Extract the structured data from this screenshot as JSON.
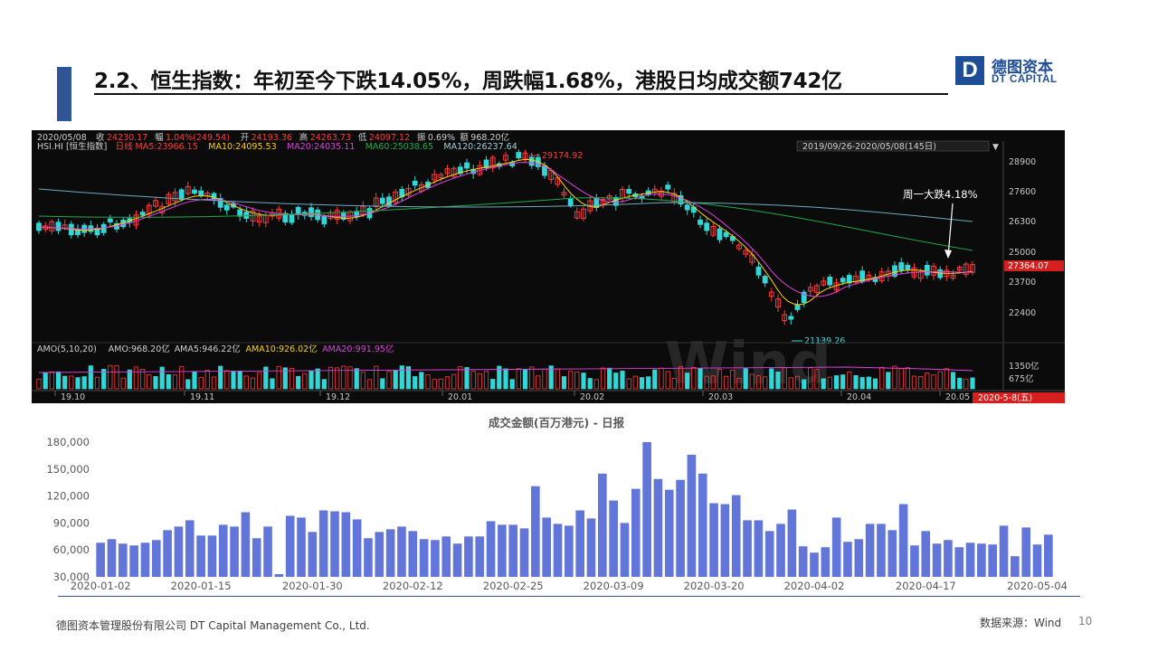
{
  "slide": {
    "title": "2.2、恒生指数：年初至今下跌14.05%，周跌幅1.68%，港股日均成交额742亿",
    "logo_letter": "D",
    "logo_cn": "德图资本",
    "logo_en": "DT CAPITAL",
    "footer_company": "德图资本管理股份有限公司  DT Capital Management  Co., Ltd.",
    "footer_source": "数据来源：Wind",
    "page_number": "10",
    "colors": {
      "accent": "#2f5597",
      "bar": "#6275d9",
      "rule": "#2f5597"
    }
  },
  "kline": {
    "header1": [
      {
        "t": "2020/05/08",
        "c": "#d0d0d0"
      },
      {
        "t": "收",
        "c": "#d0d0d0"
      },
      {
        "t": "24230.17",
        "c": "#ff3b3b"
      },
      {
        "t": "幅",
        "c": "#d0d0d0"
      },
      {
        "t": "1.04%(249.54)",
        "c": "#ff3b3b"
      },
      {
        "t": "开",
        "c": "#d0d0d0"
      },
      {
        "t": "24193.36",
        "c": "#ff3b3b"
      },
      {
        "t": "高",
        "c": "#d0d0d0"
      },
      {
        "t": "24263.73",
        "c": "#ff3b3b"
      },
      {
        "t": "低",
        "c": "#d0d0d0"
      },
      {
        "t": "24097.12",
        "c": "#ff3b3b"
      },
      {
        "t": "振",
        "c": "#d0d0d0"
      },
      {
        "t": "0.69%",
        "c": "#d0d0d0"
      },
      {
        "t": "额",
        "c": "#d0d0d0"
      },
      {
        "t": "968.20亿",
        "c": "#d0d0d0"
      }
    ],
    "header2": [
      {
        "t": "HSI.HI [恒生指数]",
        "c": "#d0d0d0"
      },
      {
        "t": "日线",
        "c": "#ff3b3b"
      },
      {
        "t": "MA5:23966.15",
        "c": "#ff3b3b"
      },
      {
        "t": "MA10:24095.53",
        "c": "#ffd200"
      },
      {
        "t": "MA20:24035.11",
        "c": "#e040e0"
      },
      {
        "t": "MA60:25038.65",
        "c": "#1faa4a"
      },
      {
        "t": "MA120:26237.64",
        "c": "#a0d0e0"
      }
    ],
    "range_label": "2019/09/26-2020/05/08(145日)",
    "y_ticks": [
      "28900",
      "27600",
      "26300",
      "25000",
      "23700",
      "22400"
    ],
    "current_price": "27364.07",
    "high_label": "29174.92",
    "low_label": "21139.26",
    "annotation": "周一大跌4.18%",
    "vol_header": [
      {
        "t": "AMO(5,10,20)",
        "c": "#d0d0d0"
      },
      {
        "t": "AMO:968.20亿",
        "c": "#d0d0d0"
      },
      {
        "t": "AMA5:946.22亿",
        "c": "#d0d0d0"
      },
      {
        "t": "AMA10:926.02亿",
        "c": "#ffd200"
      },
      {
        "t": "AMA20:991.95亿",
        "c": "#e040e0"
      }
    ],
    "vol_ticks": [
      "1350亿",
      "675亿"
    ],
    "x_labels": [
      "19.10",
      "19.11",
      "19.12",
      "20.01",
      "20.02",
      "20.03",
      "20.04",
      "20.05"
    ],
    "date_badge": "2020-5-8(五)",
    "watermark": "Wind"
  },
  "chart_data": {
    "type": "bar",
    "title": "成交金额(百万港元) - 日报",
    "xlabel": "",
    "ylabel": "",
    "ylim": [
      30000,
      180000
    ],
    "y_ticks": [
      "30,000",
      "60,000",
      "90,000",
      "120,000",
      "150,000",
      "180,000"
    ],
    "x_tick_labels": [
      "2020-01-02",
      "2020-01-15",
      "2020-01-30",
      "2020-02-12",
      "2020-02-25",
      "2020-03-09",
      "2020-03-20",
      "2020-04-02",
      "2020-04-17",
      "2020-05-04"
    ],
    "x_tick_indices": [
      0,
      9,
      19,
      28,
      37,
      46,
      55,
      64,
      74,
      84
    ],
    "values": [
      68000,
      72000,
      67000,
      65000,
      68000,
      71000,
      82000,
      86000,
      93000,
      76000,
      76000,
      88000,
      86000,
      102000,
      73000,
      86000,
      33000,
      98000,
      96000,
      80000,
      104000,
      103000,
      102000,
      94000,
      73000,
      80000,
      83000,
      86000,
      81000,
      72000,
      71000,
      75000,
      67000,
      75000,
      75000,
      92000,
      88000,
      88000,
      84000,
      131000,
      96000,
      89000,
      87000,
      104000,
      95000,
      145000,
      115000,
      90000,
      128000,
      180000,
      139000,
      127000,
      138000,
      166000,
      145000,
      112000,
      111000,
      121000,
      93000,
      93000,
      81000,
      89000,
      105000,
      64000,
      57000,
      63000,
      96000,
      69000,
      72000,
      89000,
      89000,
      82000,
      111000,
      65000,
      81000,
      67000,
      71000,
      63000,
      68000,
      67000,
      66000,
      87000,
      53000,
      85000,
      66000,
      77000
    ]
  }
}
